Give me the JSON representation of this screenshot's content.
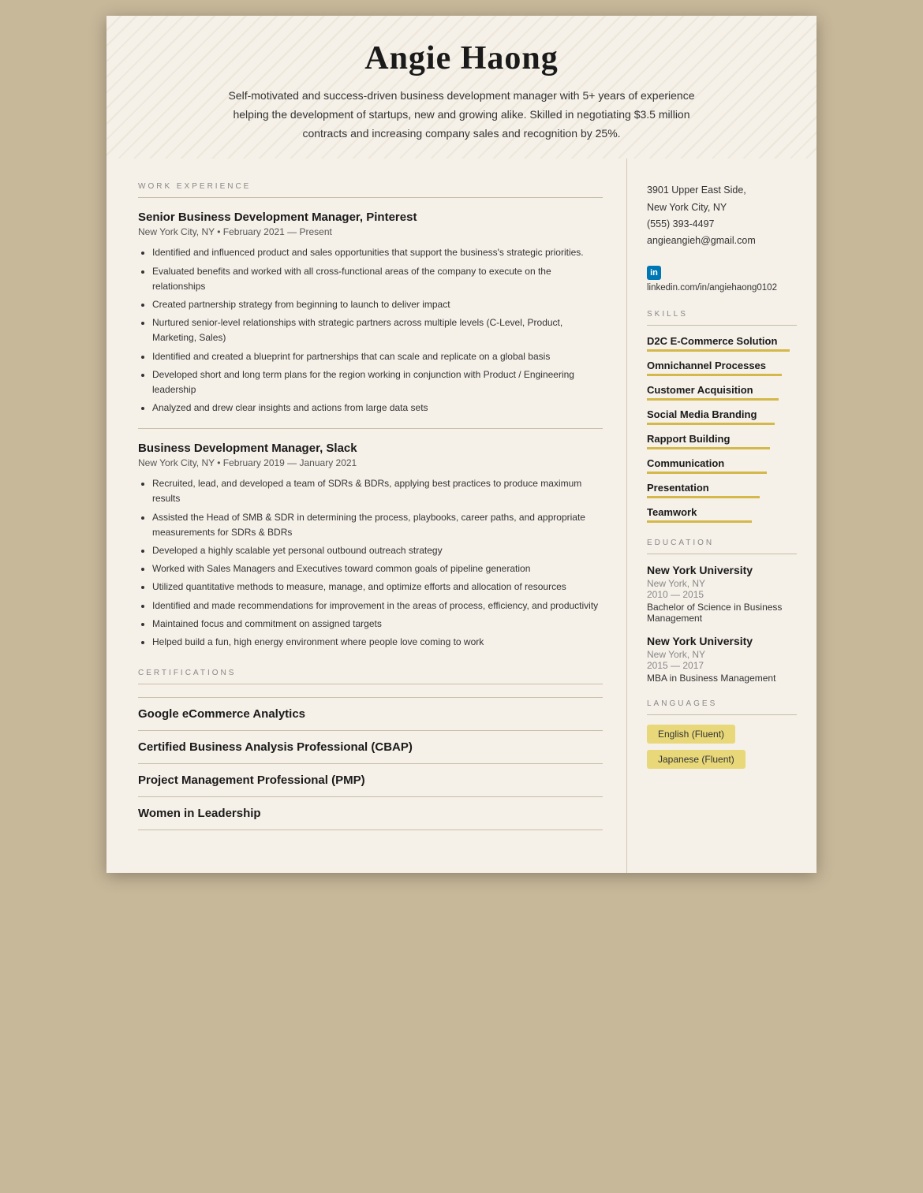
{
  "header": {
    "name": "Angie Haong",
    "summary": "Self-motivated and success-driven business development manager with 5+ years of experience helping the development of startups, new and growing alike. Skilled in negotiating $3.5 million contracts and increasing company sales and recognition by 25%."
  },
  "left": {
    "work_experience_label": "WORK EXPERIENCE",
    "jobs": [
      {
        "title": "Senior Business Development Manager, Pinterest",
        "meta": "New York City, NY • February 2021 — Present",
        "bullets": [
          "Identified and influenced product and sales opportunities that support the business's strategic priorities.",
          "Evaluated benefits and worked with all cross-functional areas of the company to execute on the relationships",
          "Created partnership strategy from beginning to launch to deliver impact",
          "Nurtured senior-level relationships with strategic partners across multiple levels (C-Level, Product, Marketing, Sales)",
          "Identified and created a blueprint for partnerships that can scale and replicate on a global basis",
          "Developed short and long term plans for the region working in conjunction with Product / Engineering leadership",
          "Analyzed and drew clear insights and actions from large data sets"
        ]
      },
      {
        "title": "Business Development Manager, Slack",
        "meta": "New York City, NY • February 2019 — January 2021",
        "bullets": [
          "Recruited, lead, and developed a team of SDRs & BDRs, applying best practices to produce maximum results",
          "Assisted the Head of SMB & SDR in determining the process, playbooks, career paths, and appropriate measurements for SDRs & BDRs",
          "Developed a highly scalable yet personal outbound outreach strategy",
          "Worked with Sales Managers and Executives toward common goals of pipeline generation",
          "Utilized quantitative methods to measure, manage, and optimize efforts and allocation of resources",
          "Identified and made recommendations for improvement in the areas of process, efficiency, and productivity",
          "Maintained focus and commitment on assigned targets",
          "Helped build a fun, high energy environment where people love coming to work"
        ]
      }
    ],
    "certifications_label": "CERTIFICATIONS",
    "certifications": [
      "Google eCommerce Analytics",
      "Certified Business Analysis Professional (CBAP)",
      "Project Management Professional (PMP)",
      "Women in Leadership"
    ]
  },
  "right": {
    "address": "3901 Upper East Side,\nNew York City, NY",
    "phone": "(555) 393-4497",
    "email": "angieangieh@gmail.com",
    "linkedin_icon": "in",
    "linkedin_url": "linkedin.com/in/angiehaong0102",
    "skills_label": "SKILLS",
    "skills": [
      {
        "name": "D2C E-Commerce Solution",
        "bar": 95
      },
      {
        "name": "Omnichannel Processes",
        "bar": 90
      },
      {
        "name": "Customer Acquisition",
        "bar": 88
      },
      {
        "name": "Social Media Branding",
        "bar": 85
      },
      {
        "name": "Rapport Building",
        "bar": 82
      },
      {
        "name": "Communication",
        "bar": 80
      },
      {
        "name": "Presentation",
        "bar": 75
      },
      {
        "name": "Teamwork",
        "bar": 70
      }
    ],
    "education_label": "EDUCATION",
    "education": [
      {
        "school": "New York University",
        "location": "New York, NY",
        "years": "2010 — 2015",
        "degree": "Bachelor of Science in Business Management"
      },
      {
        "school": "New York University",
        "location": "New York, NY",
        "years": "2015 — 2017",
        "degree": "MBA in Business Management"
      }
    ],
    "languages_label": "LANGUAGES",
    "languages": [
      "English (Fluent)",
      "Japanese (Fluent)"
    ]
  }
}
